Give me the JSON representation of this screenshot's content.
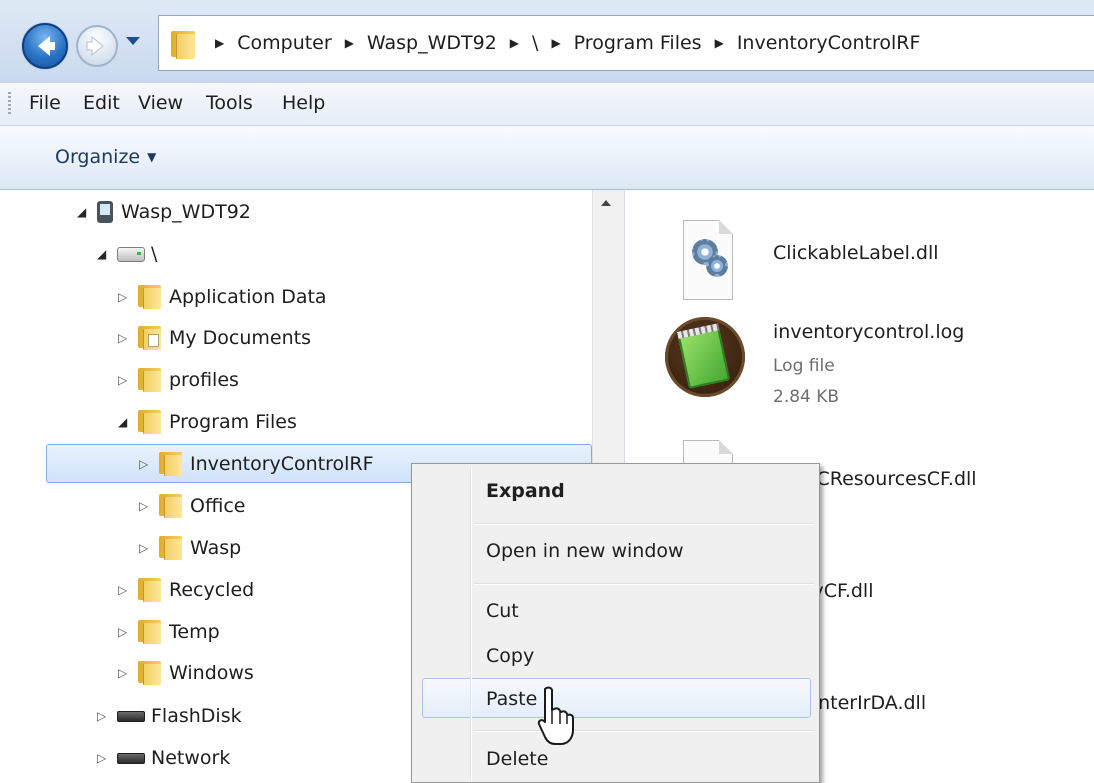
{
  "address_bar": {
    "crumbs": [
      "Computer",
      "Wasp_WDT92",
      "\\",
      "Program Files",
      "InventoryControlRF"
    ]
  },
  "menu": {
    "items": [
      "File",
      "Edit",
      "View",
      "Tools",
      "Help"
    ]
  },
  "command_bar": {
    "organize_label": "Organize"
  },
  "nav_tree": {
    "device": "Wasp_WDT92",
    "root": "\\",
    "folders": [
      "Application Data",
      "My Documents",
      "profiles",
      "Program Files"
    ],
    "program_files_children": [
      "InventoryControlRF",
      "Office",
      "Wasp"
    ],
    "more_folders": [
      "Recycled",
      "Temp",
      "Windows"
    ],
    "drives": [
      "FlashDisk",
      "Network"
    ]
  },
  "files": [
    {
      "name": "ClickableLabel.dll",
      "type": "",
      "size": "",
      "icon": "dll-icon"
    },
    {
      "name": "inventorycontrol.log",
      "type": "Log file",
      "size": "2.84 KB",
      "icon": "notepad-icon"
    },
    {
      "name": "PCResourcesCF.dll",
      "icon": "dll-icon"
    },
    {
      "name": "tyCF.dll",
      "icon": "dll-icon"
    },
    {
      "name": "rinterIrDA.dll",
      "icon": "dll-icon"
    }
  ],
  "context_menu": {
    "items": [
      "Expand",
      "Open in new window",
      "Cut",
      "Copy",
      "Paste",
      "Delete"
    ],
    "highlighted": "Paste"
  },
  "colors": {
    "selection": "#cfe3fa",
    "accent": "#2a73c6"
  }
}
